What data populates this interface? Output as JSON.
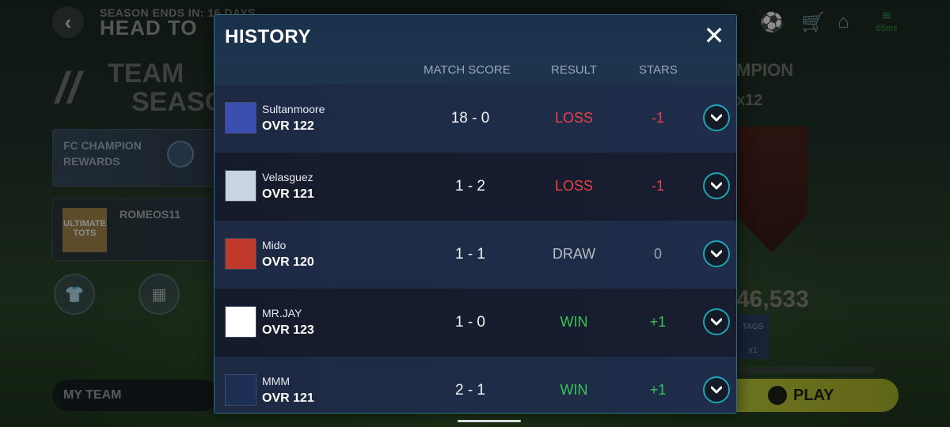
{
  "background": {
    "season_ends": "SEASON ENDS IN: 16 DAYS",
    "title": "HEAD TO",
    "tots_line1": "TEAM",
    "tots_line2": "SEASO",
    "fc_rewards": "FC CHAMPION REWARDS",
    "player_name": "ROMEOS11",
    "player_badge": "ULTIMATE TOTS",
    "my_team": "MY TEAM",
    "champion": "MPION",
    "multiplier": "x12",
    "points": "46,533",
    "tags_label": "TAGS",
    "tags_count": "x1",
    "play": "PLAY",
    "ping": "65ms"
  },
  "modal": {
    "title": "HISTORY",
    "columns": {
      "score": "MATCH SCORE",
      "result": "RESULT",
      "stars": "STARS"
    },
    "rows": [
      {
        "name": "Sultanmoore",
        "ovr": "OVR 122",
        "score": "18 - 0",
        "result": "LOSS",
        "stars": "-1",
        "avatar_color": "#3a4fb0"
      },
      {
        "name": "Velasguez",
        "ovr": "OVR 121",
        "score": "1 - 2",
        "result": "LOSS",
        "stars": "-1",
        "avatar_color": "#c9d4e2"
      },
      {
        "name": "Mido",
        "ovr": "OVR 120",
        "score": "1 - 1",
        "result": "DRAW",
        "stars": "0",
        "avatar_color": "#c0392b"
      },
      {
        "name": "MR.JAY",
        "ovr": "OVR 123",
        "score": "1 - 0",
        "result": "WIN",
        "stars": "+1",
        "avatar_color": "#ffffff"
      },
      {
        "name": "MMM",
        "ovr": "OVR 121",
        "score": "2 - 1",
        "result": "WIN",
        "stars": "+1",
        "avatar_color": "#1e2f55"
      }
    ]
  },
  "colors": {
    "loss": "#e8414a",
    "win": "#39c455",
    "draw": "#b9bec7",
    "accent": "#1ea5b3"
  }
}
